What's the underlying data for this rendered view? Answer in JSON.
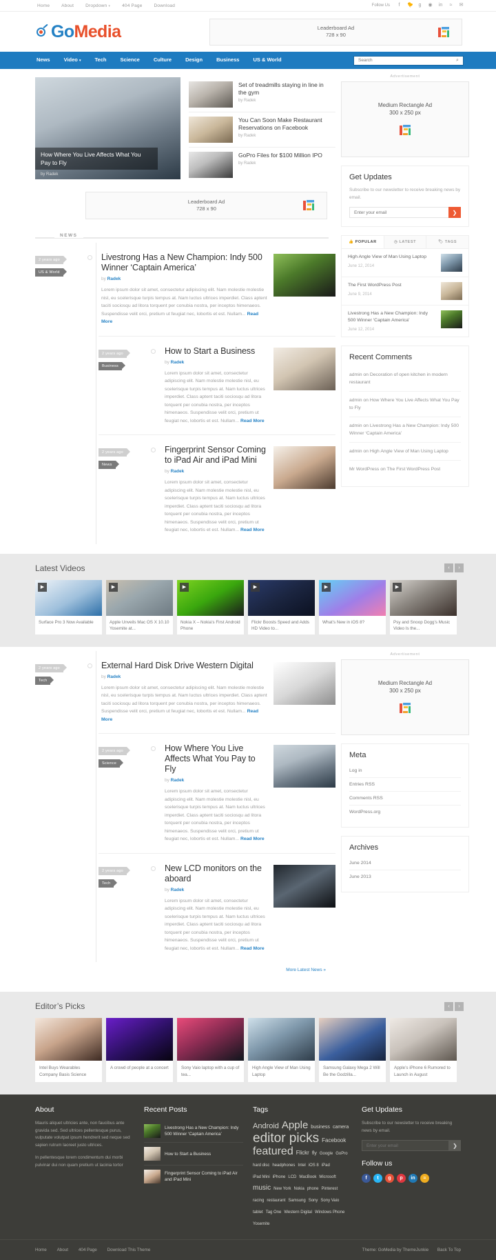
{
  "topbar": {
    "nav": [
      {
        "label": "Home"
      },
      {
        "label": "About"
      },
      {
        "label": "Dropdown",
        "caret": "▾"
      },
      {
        "label": "404 Page"
      },
      {
        "label": "Download"
      }
    ],
    "follow_label": "Follow Us",
    "social": [
      {
        "name": "facebook-icon",
        "glyph": "f"
      },
      {
        "name": "twitter-icon",
        "glyph": "🐦"
      },
      {
        "name": "google-plus-icon",
        "glyph": "g"
      },
      {
        "name": "pinterest-icon",
        "glyph": "◉"
      },
      {
        "name": "linkedin-icon",
        "glyph": "in"
      },
      {
        "name": "rss-icon",
        "glyph": "≈"
      },
      {
        "name": "email-icon",
        "glyph": "✉"
      }
    ]
  },
  "header": {
    "logo_go": "Go",
    "logo_media": "Media",
    "leaderboard_line1": "Leaderboard Ad",
    "leaderboard_line2": "728 x 90"
  },
  "nav": {
    "items": [
      {
        "label": "News"
      },
      {
        "label": "Video",
        "caret": "▾"
      },
      {
        "label": "Tech"
      },
      {
        "label": "Science"
      },
      {
        "label": "Culture"
      },
      {
        "label": "Design"
      },
      {
        "label": "Business"
      },
      {
        "label": "US & World"
      }
    ],
    "search_placeholder": "Search",
    "search_value": ""
  },
  "featured": {
    "main": {
      "title": "How Where You Live Affects What You Pay to Fly",
      "byline": "by Radek"
    },
    "list": [
      {
        "title": "Set of treadmills staying in line in the gym",
        "byline": "by Radek"
      },
      {
        "title": "You Can Soon Make Restaurant Reservations on Facebook",
        "byline": "by Radek"
      },
      {
        "title": "GoPro Files for $100 Million IPO",
        "byline": "by Radek"
      }
    ]
  },
  "mid_ad": {
    "line1": "Leaderboard Ad",
    "line2": "728 x 90"
  },
  "news_section": {
    "tab_label": "NEWS",
    "more_label": "More Latest News »",
    "excerpt": "Lorem ipsum dolor sit amet, consectetur adipiscing elit. Nam molestie molestie nisl, eu scelerisque turpis tempus at. Nam luctus ultrices imperdiet. Class aptent taciti sociosqu ad litora torquent per conubia nostra, per inceptos himenaeos. Suspendisse velit orci, pretium ut feugiat nec, lobortis et est. Nullam...",
    "read_more": "Read More",
    "posts_top": [
      {
        "age": "2 years ago",
        "category": "US & World",
        "title": "Livestrong Has a New Champion: Indy 500 Winner ‘Captain America’",
        "by_prefix": "by ",
        "author": "Radek",
        "thumb": "ph-horse"
      },
      {
        "age": "2 years ago",
        "category": "Business",
        "title": "How to Start a Business",
        "by_prefix": "by ",
        "author": "Radek",
        "thumb": "ph-write"
      },
      {
        "age": "2 years ago",
        "category": "News",
        "title": "Fingerprint Sensor Coming to iPad Air and iPad Mini",
        "by_prefix": "by ",
        "author": "Radek",
        "thumb": "ph-ipad"
      }
    ],
    "posts_bottom": [
      {
        "age": "2 years ago",
        "category": "Tech",
        "title": "External Hard Disk Drive Western Digital",
        "by_prefix": "by ",
        "author": "Radek",
        "thumb": "ph-hdd"
      },
      {
        "age": "2 years ago",
        "category": "Science",
        "title": "How Where You Live Affects What You Pay to Fly",
        "by_prefix": "by ",
        "author": "Radek",
        "thumb": "ph-plane"
      },
      {
        "age": "2 years ago",
        "category": "Tech",
        "title": "New LCD monitors on the aboard",
        "by_prefix": "by ",
        "author": "Radek",
        "thumb": "ph-lcd"
      }
    ]
  },
  "sidebar": {
    "adv_label": "Advertisement",
    "mrec_line1": "Medium Rectangle Ad",
    "mrec_line2": "300 x 250 px",
    "get_updates": {
      "title": "Get Updates",
      "desc": "Subscribe to our newsletter to receive breaking news by email.",
      "placeholder": "Enter your email",
      "button": "❯"
    },
    "tabs": [
      {
        "label": "POPULAR",
        "icon": "👍",
        "active": true
      },
      {
        "label": "LATEST",
        "icon": "◷",
        "active": false
      },
      {
        "label": "TAGS",
        "icon": "🏷",
        "active": false
      }
    ],
    "popular": [
      {
        "title": "High Angle View of Man Using Laptop",
        "date": "June 12, 2014",
        "thumb": "ph-laptop"
      },
      {
        "title": "The First WordPress Post",
        "date": "June 9, 2014",
        "thumb": "ph-rest"
      },
      {
        "title": "Livestrong Has a New Champion: Indy 500 Winner ‘Captain America’",
        "date": "June 12, 2014",
        "thumb": "ph-horse"
      }
    ],
    "recent_comments": {
      "title": "Recent Comments",
      "items": [
        "admin on Decoration of open kitchen in modern restaurant",
        "admin on How Where You Live Affects What You Pay to Fly",
        "admin on Livestrong Has a New Champion: Indy 500 Winner ‘Captain America’",
        "admin on High Angle View of Man Using Laptop",
        "Mr WordPress on The First WordPress Post"
      ]
    },
    "meta": {
      "title": "Meta",
      "items": [
        "Log in",
        "Entries RSS",
        "Comments RSS",
        "WordPress.org"
      ]
    },
    "archives": {
      "title": "Archives",
      "items": [
        "June 2014",
        "June 2013"
      ]
    }
  },
  "latest_videos": {
    "title": "Latest Videos",
    "prev": "‹",
    "next": "›",
    "cards": [
      {
        "title": "Surface Pro 3 Now Available",
        "thumb": "ph-surface"
      },
      {
        "title": "Apple Unveils Mac OS X 10.10 Yosemite at...",
        "thumb": "ph-osx"
      },
      {
        "title": "Nokia X – Nokia’s First Android Phone",
        "thumb": "ph-nokia"
      },
      {
        "title": "Flickr Boosts Speed and Adds HD Video to...",
        "thumb": "ph-flickr"
      },
      {
        "title": "What’s New in iOS 8?",
        "thumb": "ph-ios8"
      },
      {
        "title": "Psy and Snoop Dogg’s Music Video Is the...",
        "thumb": "ph-snoop"
      }
    ]
  },
  "editors_picks": {
    "title": "Editor’s Picks",
    "prev": "‹",
    "next": "›",
    "cards": [
      {
        "title": "Intel Buys Wearables Company Basis Science",
        "thumb": "ph-intel"
      },
      {
        "title": "A crowd of people at a concert",
        "thumb": "ph-crowd"
      },
      {
        "title": "Sony Vaio laptop with a cup of tea...",
        "thumb": "ph-vaio"
      },
      {
        "title": "High Angle View of Man Using Laptop",
        "thumb": "ph-laptop"
      },
      {
        "title": "Samsung Galaxy Mega 2 Will Be the Godzilla...",
        "thumb": "ph-galaxy"
      },
      {
        "title": "Apple’s iPhone 6 Rumored to Launch in August",
        "thumb": "ph-iphone"
      }
    ]
  },
  "footer": {
    "about": {
      "title": "About",
      "p1": "Mauris aliquet ultricies ante, non faucibus ante gravida sed. Sed ultrices pellentesque purus, vulputate volutpat ipsum hendrerit sed neque sed sapien rutrum laoreet justo ultrices.",
      "p2": "In pellentesque lorem condimentum dui morbi pulvinar dui non quam pretium ut lacinia tortor"
    },
    "recent_posts": {
      "title": "Recent Posts",
      "items": [
        {
          "title": "Livestrong Has a New Champion: Indy 500 Winner ‘Captain America’",
          "thumb": "ph-horse"
        },
        {
          "title": "How to Start a Business",
          "thumb": "ph-write"
        },
        {
          "title": "Fingerprint Sensor Coming to iPad Air and iPad Mini",
          "thumb": "ph-ipad"
        }
      ]
    },
    "tags": {
      "title": "Tags",
      "items": [
        {
          "label": "Android",
          "size": 11
        },
        {
          "label": "Apple",
          "size": 15
        },
        {
          "label": "business",
          "size": 7
        },
        {
          "label": "camera",
          "size": 7
        },
        {
          "label": "editor picks",
          "size": 19
        },
        {
          "label": "Facebook",
          "size": 8
        },
        {
          "label": "featured",
          "size": 16
        },
        {
          "label": "Flickr",
          "size": 8
        },
        {
          "label": "fly",
          "size": 7
        },
        {
          "label": "Google",
          "size": 6
        },
        {
          "label": "GoPro",
          "size": 6
        },
        {
          "label": "hard disc",
          "size": 6
        },
        {
          "label": "headphones",
          "size": 6
        },
        {
          "label": "Intel",
          "size": 6
        },
        {
          "label": "iOS 8",
          "size": 6
        },
        {
          "label": "iPad",
          "size": 6
        },
        {
          "label": "iPad Mini",
          "size": 6
        },
        {
          "label": "iPhone",
          "size": 6
        },
        {
          "label": "LCD",
          "size": 6
        },
        {
          "label": "MacBook",
          "size": 6
        },
        {
          "label": "Microsoft",
          "size": 6
        },
        {
          "label": "music",
          "size": 10
        },
        {
          "label": "New York",
          "size": 6
        },
        {
          "label": "Nokia",
          "size": 6
        },
        {
          "label": "phone",
          "size": 6
        },
        {
          "label": "Pinterest",
          "size": 6
        },
        {
          "label": "racing",
          "size": 6
        },
        {
          "label": "restaurant",
          "size": 6
        },
        {
          "label": "Samsung",
          "size": 6
        },
        {
          "label": "Sony",
          "size": 6
        },
        {
          "label": "Sony Vaio",
          "size": 6
        },
        {
          "label": "tablet",
          "size": 6
        },
        {
          "label": "Tag One",
          "size": 6
        },
        {
          "label": "Western Digital",
          "size": 6
        },
        {
          "label": "Windows Phone",
          "size": 6
        },
        {
          "label": "Yosemite",
          "size": 6
        }
      ]
    },
    "get_updates": {
      "title": "Get Updates",
      "desc": "Subscribe to our newsletter to receive breaking news by email.",
      "placeholder": "Enter your email",
      "button": "❯"
    },
    "follow_us": {
      "title": "Follow us",
      "social": [
        {
          "name": "facebook-icon",
          "glyph": "f",
          "color": "#3b5998"
        },
        {
          "name": "twitter-icon",
          "glyph": "t",
          "color": "#29b6f6"
        },
        {
          "name": "google-plus-icon",
          "glyph": "g",
          "color": "#e8533a"
        },
        {
          "name": "pinterest-icon",
          "glyph": "p",
          "color": "#e0373f"
        },
        {
          "name": "linkedin-icon",
          "glyph": "in",
          "color": "#2079b5"
        },
        {
          "name": "rss-icon",
          "glyph": "≈",
          "color": "#f0ad20"
        }
      ]
    },
    "bottom_links": [
      "Home",
      "About",
      "404 Page",
      "Download This Theme"
    ],
    "credit": "Theme: GoMedia by ThemeJunkie",
    "back_to_top": "Back To Top"
  }
}
